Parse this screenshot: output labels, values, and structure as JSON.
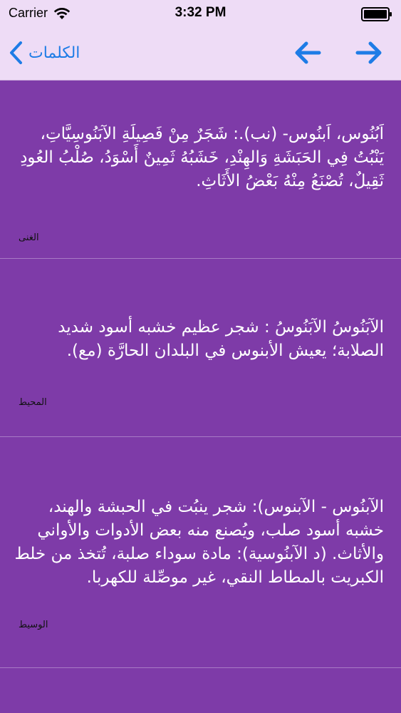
{
  "status_bar": {
    "carrier": "Carrier",
    "time": "3:32 PM"
  },
  "nav": {
    "back_label": "الكلمات",
    "accent_color": "#1e7ce6"
  },
  "entries": [
    {
      "text": "اَبُنُوس، اَبنُوس- (نب).: شَجَرٌ مِنْ فَصِيلَةِ الآبَنُوسِيَّاتِ، يَنْبُتُ فِي الحَبَشَةِ وَالهِنْدِ، خَشَبُهُ ثَمِينٌ أَسْوَدُ، صُلْبُ العُودِ ثَقِيلٌ، تُصْنَعُ مِنْهُ بَعْضُ الأَثَاثِ.",
      "source": "الغنى"
    },
    {
      "text": "الآبَنُوسُ الآبَنُوسُ : شجر عظيم خشبه أسود شديد الصلابة؛ يعيش الأبنوس في البلدان الحارَّة (مع).",
      "source": "المحيط"
    },
    {
      "text": "الآبنُوس - الآبنوس): شجر ينبُت في الحبشة والهند، خشبه أسود صلب، ويُصنع منه بعض الأدوات والأواني والأثاث. (د الآبنُوسية): مادة سوداء صلبة، تُتخذ من خلط الكبريت بالمطاط النقي، غير موصِّلة للكهربا.",
      "source": "الوسيط"
    }
  ],
  "colors": {
    "header_bg": "#eedcf6",
    "content_bg": "#7e3ba8",
    "text": "#ffffff"
  }
}
